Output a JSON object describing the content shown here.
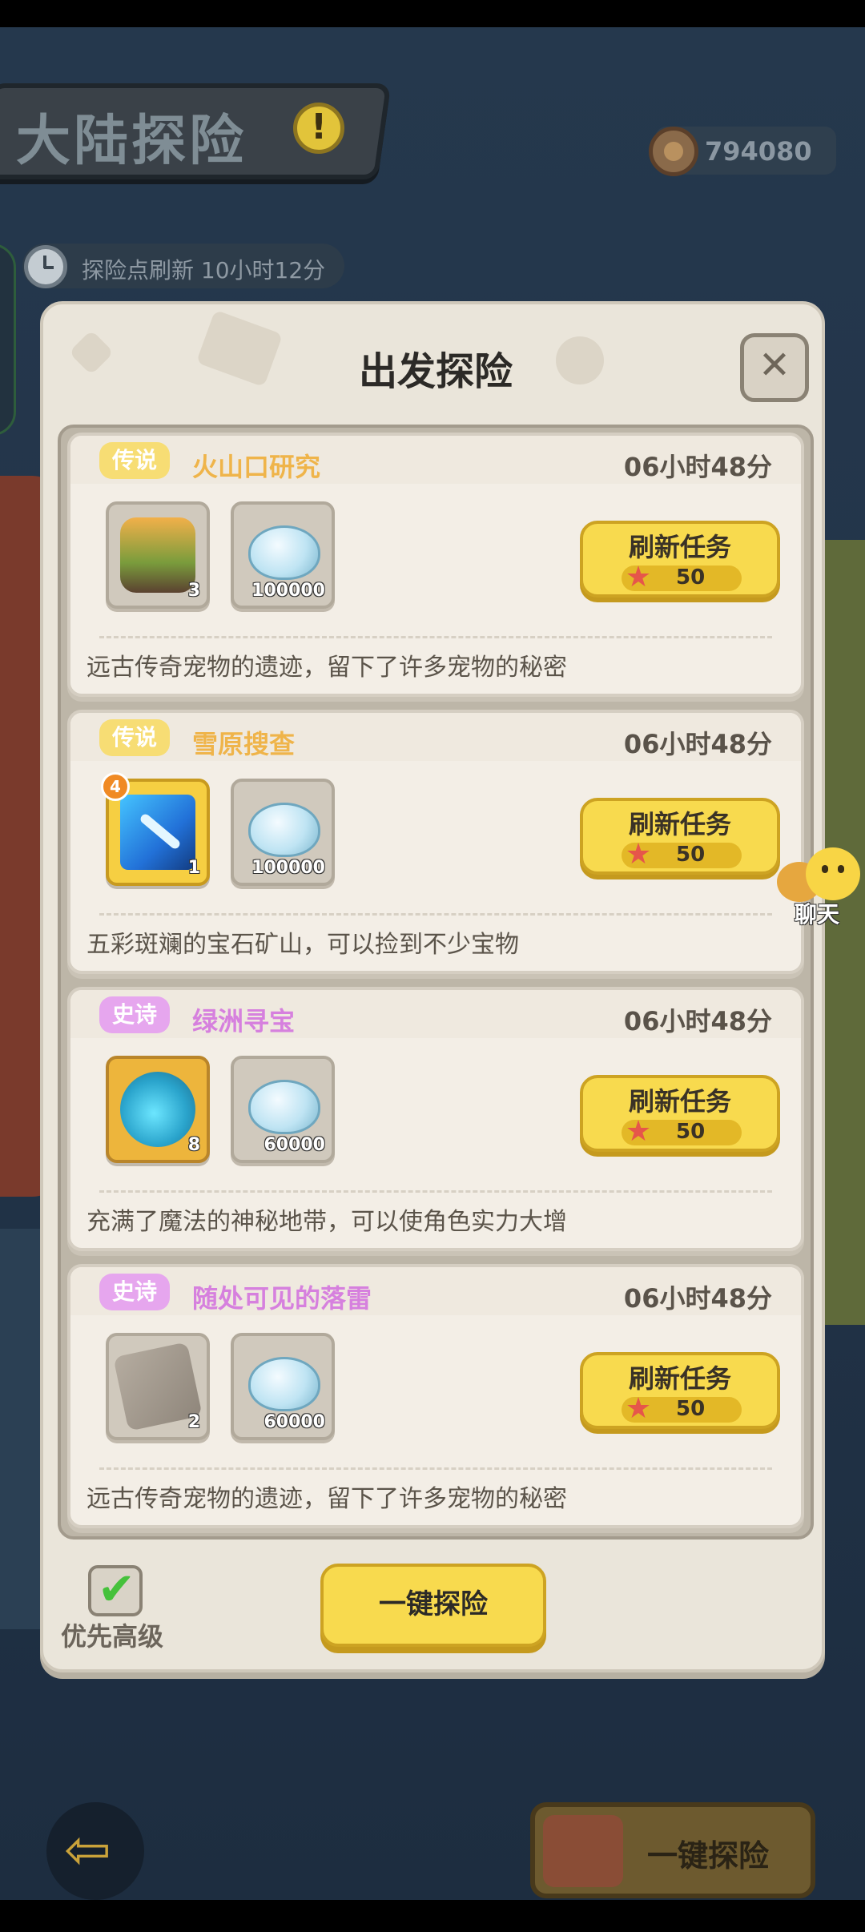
{
  "header": {
    "title": "大陆探险",
    "info_icon": "exclamation-icon",
    "currency_value": "794080",
    "currency_icon": "medal-icon"
  },
  "refresh": {
    "label": "探险点刷新",
    "time": "10小时12分"
  },
  "dialog": {
    "title": "出发探险",
    "close_icon": "close-icon",
    "refresh_button_label": "刷新任务",
    "refresh_cost": "50",
    "cost_icon": "starfish-icon",
    "priority_label": "优先高级",
    "priority_checked": true,
    "explore_all_label": "一键探险"
  },
  "tasks": [
    {
      "rarity": "传说",
      "name": "火山口研究",
      "time": "06小时48分",
      "rewards": [
        {
          "icon": "food-plate-icon",
          "count": "3"
        },
        {
          "icon": "shell-icon",
          "count": "100000"
        }
      ],
      "description": "远古传奇宠物的遗迹，留下了许多宠物的秘密"
    },
    {
      "rarity": "传说",
      "name": "雪原搜查",
      "time": "06小时48分",
      "rewards": [
        {
          "icon": "ice-sword-icon",
          "count": "1",
          "level": "4"
        },
        {
          "icon": "shell-icon",
          "count": "100000"
        }
      ],
      "description": "五彩斑斓的宝石矿山，可以捡到不少宝物"
    },
    {
      "rarity": "史诗",
      "name": "绿洲寻宝",
      "time": "06小时48分",
      "rewards": [
        {
          "icon": "potion-icon",
          "count": "8"
        },
        {
          "icon": "shell-icon",
          "count": "60000"
        }
      ],
      "description": "充满了魔法的神秘地带，可以使角色实力大增"
    },
    {
      "rarity": "史诗",
      "name": "随处可见的落雷",
      "time": "06小时48分",
      "rewards": [
        {
          "icon": "stone-scroll-icon",
          "count": "2"
        },
        {
          "icon": "shell-icon",
          "count": "60000"
        }
      ],
      "description": "远古传奇宠物的遗迹，留下了许多宠物的秘密"
    }
  ],
  "chat": {
    "label": "聊天"
  },
  "bottom": {
    "back_icon": "back-arrow-icon",
    "quick_explore_label": "一键探险"
  },
  "colors": {
    "accent_yellow": "#f8da4e",
    "legend_tag": "#f7dd74",
    "epic_tag": "#e6a6ee",
    "legend_name": "#efb44a",
    "epic_name": "#d680de"
  }
}
